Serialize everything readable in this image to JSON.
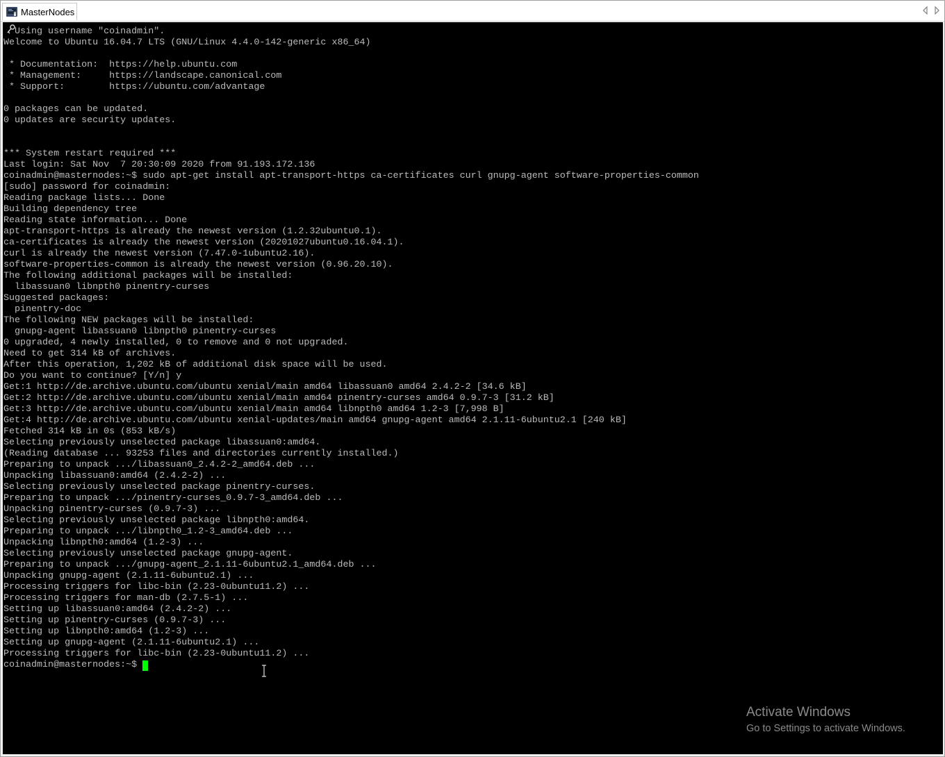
{
  "window": {
    "tab_title": "MasterNodes"
  },
  "terminal": {
    "lines": [
      "  Using username \"coinadmin\".",
      "Welcome to Ubuntu 16.04.7 LTS (GNU/Linux 4.4.0-142-generic x86_64)",
      "",
      " * Documentation:  https://help.ubuntu.com",
      " * Management:     https://landscape.canonical.com",
      " * Support:        https://ubuntu.com/advantage",
      "",
      "0 packages can be updated.",
      "0 updates are security updates.",
      "",
      "",
      "*** System restart required ***",
      "Last login: Sat Nov  7 20:30:09 2020 from 91.193.172.136",
      "coinadmin@masternodes:~$ sudo apt-get install apt-transport-https ca-certificates curl gnupg-agent software-properties-common",
      "[sudo] password for coinadmin:",
      "Reading package lists... Done",
      "Building dependency tree",
      "Reading state information... Done",
      "apt-transport-https is already the newest version (1.2.32ubuntu0.1).",
      "ca-certificates is already the newest version (20201027ubuntu0.16.04.1).",
      "curl is already the newest version (7.47.0-1ubuntu2.16).",
      "software-properties-common is already the newest version (0.96.20.10).",
      "The following additional packages will be installed:",
      "  libassuan0 libnpth0 pinentry-curses",
      "Suggested packages:",
      "  pinentry-doc",
      "The following NEW packages will be installed:",
      "  gnupg-agent libassuan0 libnpth0 pinentry-curses",
      "0 upgraded, 4 newly installed, 0 to remove and 0 not upgraded.",
      "Need to get 314 kB of archives.",
      "After this operation, 1,202 kB of additional disk space will be used.",
      "Do you want to continue? [Y/n] y",
      "Get:1 http://de.archive.ubuntu.com/ubuntu xenial/main amd64 libassuan0 amd64 2.4.2-2 [34.6 kB]",
      "Get:2 http://de.archive.ubuntu.com/ubuntu xenial/main amd64 pinentry-curses amd64 0.9.7-3 [31.2 kB]",
      "Get:3 http://de.archive.ubuntu.com/ubuntu xenial/main amd64 libnpth0 amd64 1.2-3 [7,998 B]",
      "Get:4 http://de.archive.ubuntu.com/ubuntu xenial-updates/main amd64 gnupg-agent amd64 2.1.11-6ubuntu2.1 [240 kB]",
      "Fetched 314 kB in 0s (853 kB/s)",
      "Selecting previously unselected package libassuan0:amd64.",
      "(Reading database ... 93253 files and directories currently installed.)",
      "Preparing to unpack .../libassuan0_2.4.2-2_amd64.deb ...",
      "Unpacking libassuan0:amd64 (2.4.2-2) ...",
      "Selecting previously unselected package pinentry-curses.",
      "Preparing to unpack .../pinentry-curses_0.9.7-3_amd64.deb ...",
      "Unpacking pinentry-curses (0.9.7-3) ...",
      "Selecting previously unselected package libnpth0:amd64.",
      "Preparing to unpack .../libnpth0_1.2-3_amd64.deb ...",
      "Unpacking libnpth0:amd64 (1.2-3) ...",
      "Selecting previously unselected package gnupg-agent.",
      "Preparing to unpack .../gnupg-agent_2.1.11-6ubuntu2.1_amd64.deb ...",
      "Unpacking gnupg-agent (2.1.11-6ubuntu2.1) ...",
      "Processing triggers for libc-bin (2.23-0ubuntu11.2) ...",
      "Processing triggers for man-db (2.7.5-1) ...",
      "Setting up libassuan0:amd64 (2.4.2-2) ...",
      "Setting up pinentry-curses (0.9.7-3) ...",
      "Setting up libnpth0:amd64 (1.2-3) ...",
      "Setting up gnupg-agent (2.1.11-6ubuntu2.1) ...",
      "Processing triggers for libc-bin (2.23-0ubuntu11.2) ..."
    ],
    "prompt": "coinadmin@masternodes:~$"
  },
  "activation": {
    "title": "Activate Windows",
    "subtitle": "Go to Settings to activate Windows."
  },
  "colors": {
    "terminal_bg": "#000000",
    "terminal_fg": "#bbbbbb",
    "cursor": "#00ff00"
  },
  "icons": {
    "tab": "putty-terminal-icon",
    "login": "key-icon",
    "nav_left": "arrow-left-icon",
    "nav_right": "arrow-right-icon",
    "pointer": "text-cursor-icon"
  }
}
